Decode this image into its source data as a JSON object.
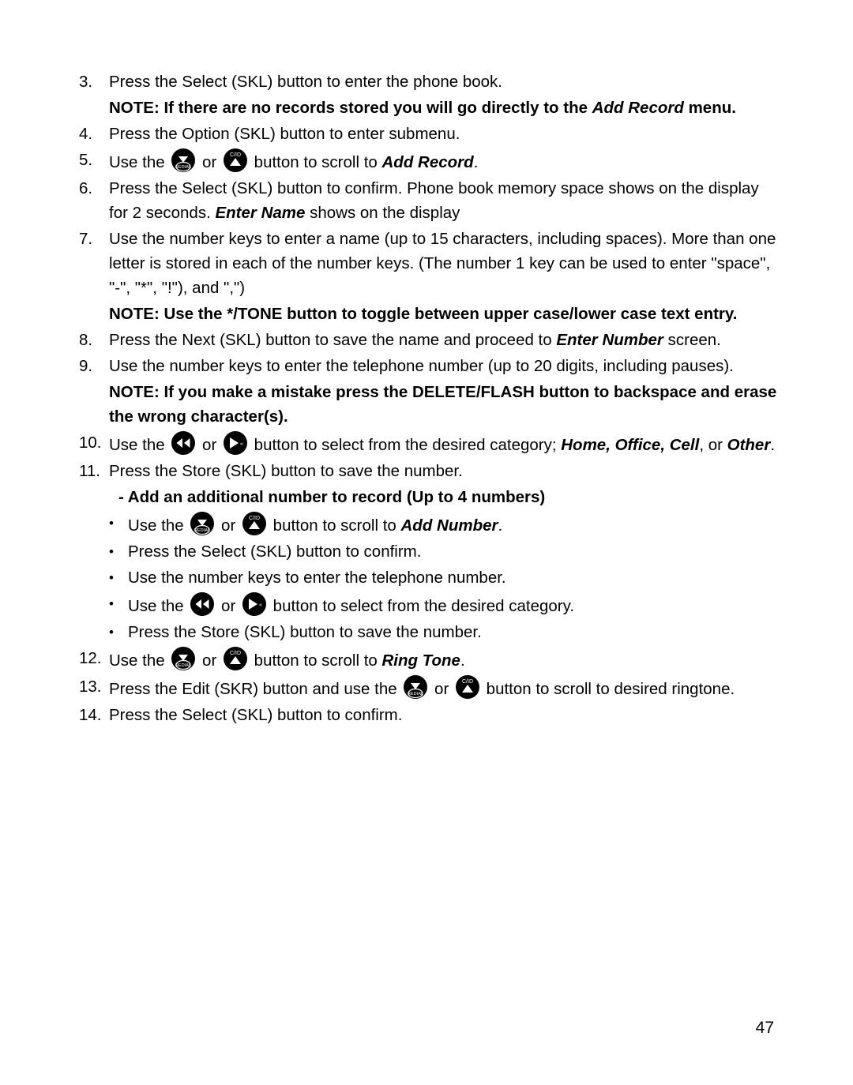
{
  "document": {
    "page_number": "47",
    "steps": [
      {
        "number": "3.",
        "text_before": "Press the Select (SKL) button to enter the phone book.",
        "icons": []
      },
      {
        "number": "4.",
        "text_before": "Press the Option (SKL) button to enter submenu.",
        "icons": []
      },
      {
        "number": "5.",
        "text_before": "Use the ",
        "icon1": "down-redial-button-icon",
        "text_mid": " or ",
        "icon2": "up-cid-button-icon",
        "text_after": " button to scroll to ",
        "emphasis": "Add Record",
        "text_end": "."
      },
      {
        "number": "6.",
        "text_before": "Press the Select (SKL) button to confirm. Phone book memory space shows on the display for 2 seconds. ",
        "emphasis": "Enter Name",
        "text_end": " shows on the display"
      },
      {
        "number": "7.",
        "text_before": "Use the number keys to enter a name (up to 15 characters, including spaces). More than one letter is stored in each of the number keys. (The number 1 key can be used to enter \"space\", \"-\", \"*\", \"!\"), and \",\")"
      },
      {
        "number": "8.",
        "text_before": "Press the Next (SKL) button to save the name and proceed to ",
        "emphasis": "Enter Number",
        "text_end": " screen."
      },
      {
        "number": "9.",
        "text_before": "Use the number keys to enter the telephone number (up to 20 digits, including pauses)."
      },
      {
        "number": "10.",
        "text_before": "Use the ",
        "icon1": "rewind-button-icon",
        "text_mid": " or ",
        "icon2": "play-forward-button-icon",
        "text_after": " button to select from the desired category; ",
        "emphasis": "Home, Office, Cell",
        "text_end": ", or ",
        "emphasis2": "Other",
        "text_end2": "."
      },
      {
        "number": "11.",
        "text_before": "Press the Store (SKL) button to save the number."
      },
      {
        "number": "12.",
        "text_before": "Use the ",
        "icon1": "down-redial-button-icon",
        "text_mid": " or ",
        "icon2": "up-cid-button-icon",
        "text_after": " button to scroll to ",
        "emphasis": "Ring Tone",
        "text_end": "."
      },
      {
        "number": "13.",
        "text_before": "Press the Edit (SKR) button and use the ",
        "icon1": "down-redial-button-icon",
        "text_mid": " or ",
        "icon2": "up-cid-button-icon",
        "text_after": " button to scroll to desired ringtone."
      },
      {
        "number": "14.",
        "text_before": "Press the Select (SKL) button to confirm."
      }
    ],
    "note_1": {
      "prefix": "NOTE: If there are no records stored you will go directly to the ",
      "italic": "Add Record",
      "suffix": " menu."
    },
    "note_2": {
      "text": "NOTE: Use the */TONE button to toggle between upper case/lower case text entry."
    },
    "note_3": {
      "text": "NOTE: If you make a mistake press the DELETE/FLASH button to backspace and erase the wrong character(s)."
    },
    "subsection": {
      "heading": "- Add an additional number to record (Up to 4 numbers)",
      "bullet_char": "•",
      "bullets": [
        {
          "text_before": "Use the ",
          "icon1": "down-redial-button-icon",
          "text_mid": " or ",
          "icon2": "up-cid-button-icon",
          "text_after": " button to scroll to ",
          "emphasis": "Add Number",
          "text_end": "."
        },
        {
          "text_before": "Press the Select (SKL) button to confirm."
        },
        {
          "text_before": "Use the number keys to enter the telephone number."
        },
        {
          "text_before": "Use the ",
          "icon1": "rewind-button-icon",
          "text_mid": " or ",
          "icon2": "play-forward-button-icon",
          "text_after": " button to select from the desired category."
        },
        {
          "text_before": "Press the Store (SKL) button to save the number."
        }
      ]
    },
    "icon_labels": {
      "redial": "REDIAL",
      "cid": "C/ID"
    }
  }
}
